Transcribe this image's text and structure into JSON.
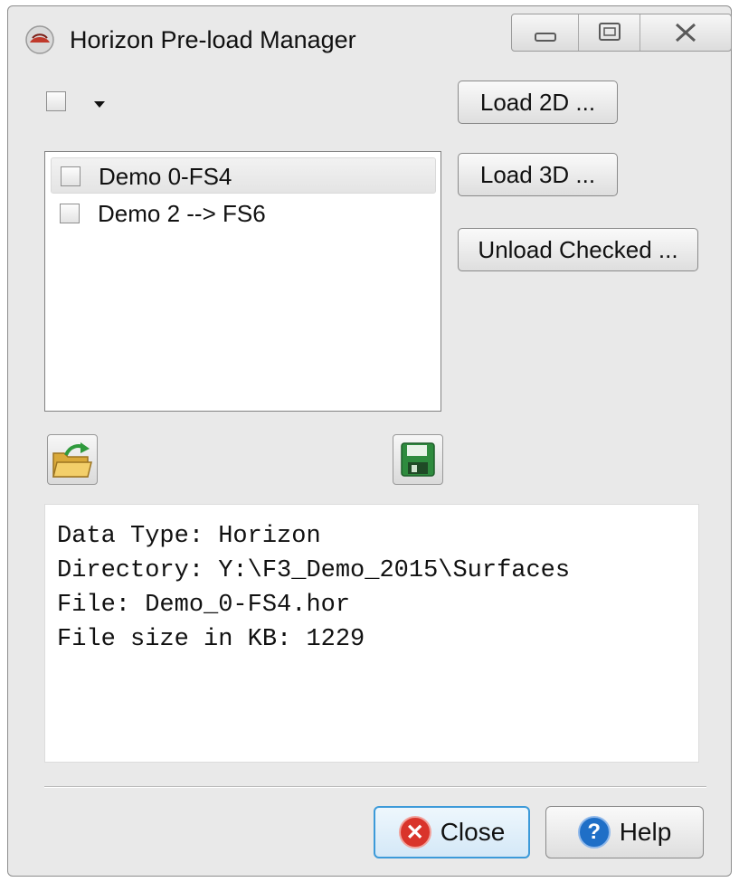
{
  "window": {
    "title": "Horizon Pre-load Manager"
  },
  "toolbar": {
    "load_2d": "Load 2D ...",
    "load_3d": "Load 3D ...",
    "unload_checked": "Unload Checked ..."
  },
  "list": {
    "items": [
      {
        "label": "Demo 0-FS4",
        "checked": false,
        "selected": true
      },
      {
        "label": "Demo 2 --> FS6",
        "checked": false,
        "selected": false
      }
    ]
  },
  "info": {
    "lines": [
      "Data Type: Horizon",
      "Directory: Y:\\F3_Demo_2015\\Surfaces",
      "File: Demo_0-FS4.hor",
      "File size in KB: 1229"
    ]
  },
  "footer": {
    "close_label": "Close",
    "help_label": "Help"
  },
  "icons": {
    "app": "horizon-app-icon",
    "open": "open-folder-icon",
    "save": "save-disk-icon",
    "close": "close-x-icon",
    "help": "help-question-icon"
  },
  "colors": {
    "close_focus_border": "#3c9ad9",
    "close_icon": "#d9342b",
    "help_icon": "#1f6fc7"
  }
}
